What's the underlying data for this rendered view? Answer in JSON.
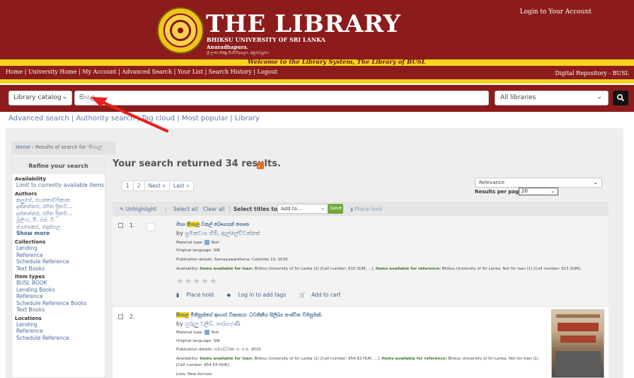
{
  "banner": {
    "title": "THE LIBRARY",
    "subtitle": "BHIKSU UNIVERSITY OF SRI LANKA",
    "city": "Anuradhapura.",
    "tagline": "ශ්‍රී ලංකා භික්ෂු විශ්වවිද්‍යාලය, අනුරාධපුරය.",
    "login": "Login to Your Account",
    "welcome": "Welcome to the Library System, The Library of BUSL"
  },
  "topnav": {
    "links": [
      "Home",
      "University Home",
      "My Account",
      "Advanced Search",
      "Your List",
      "Search History",
      "Logout"
    ],
    "separator": " | ",
    "repository": "Digital Repository - BUSL"
  },
  "search": {
    "catalog": "Library catalog",
    "query": "සිංහල",
    "library": "All libraries"
  },
  "subnav": {
    "items": [
      "Advanced search",
      "Authority search",
      "Tag cloud",
      "Most popular",
      "Library"
    ],
    "separator": " | "
  },
  "breadcrumb": {
    "home": "Home",
    "current": "Results of search for 'සිංහල'"
  },
  "facets": {
    "heading": "Refine your search",
    "availability_label": "Availability",
    "availability_item": "Limit to currently available items",
    "authors_label": "Authors",
    "authors": [
      "කලුපේ, ජයකොඩිපිකාන",
      "දන්නන්නර, රජිත ප්‍රිතම්...",
      "දන්නන්නර, රජිත ප්‍රිතම්...",
      "මූලිංග, පී. එස්. වී",
      "ජයසෙකර, දොන්ගල"
    ],
    "show_more": "Show more",
    "collections_label": "Collections",
    "collections": [
      "Lending",
      "Reference",
      "Schedule Reference",
      "Text Books"
    ],
    "itemtypes_label": "Item types",
    "itemtypes": [
      "BUSL BOOK",
      "Lending Books",
      "Reference",
      "Schedule Reference Books",
      "Text Books"
    ],
    "locations_label": "Locations",
    "locations": [
      "Lending",
      "Reference",
      "Schedule Reference"
    ]
  },
  "results": {
    "summary": "Your search returned 34 results.",
    "pager": [
      "1",
      "2",
      "Next »",
      "Last »"
    ],
    "sort": "Relevance",
    "rpp_label": "Results per page:",
    "rpp": "20",
    "toolbar": {
      "unhighlight": "Unhighlight",
      "select_all": "Select all",
      "clear_all": "Clear all",
      "select_titles": "Select titles to:",
      "add_to": "Add to...",
      "save": "Save",
      "place_hold": "Place hold"
    },
    "records": [
      {
        "num": "1.",
        "title_pre": "මහා ",
        "title_hl": "සිංහල",
        "title_post": " වසල් බෞගයන් ගෞන",
        "by_prefix": "by",
        "author": "සුමනවංශ හිමි, ඇල්ලේව්වත්තේ",
        "material_label": "Material type:",
        "material": "Text",
        "language": "Original language: SIN",
        "publication": "Publication details: Samayawardhana: Colombo 10, 2018",
        "avail_label": "Availability:",
        "avail_loan_label": "Items available for loan:",
        "avail_loan": "Bhiksu University of Sri Lanka (2) [Call number: 615 SUM, ...].",
        "avail_ref_label": "Items available for reference:",
        "avail_ref": "Bhiksu University of Sri Lanka: Not for loan (1) [Call number: 615 SUM].",
        "actions": [
          "Place hold",
          "Log in to add tags",
          "Add to cart"
        ]
      },
      {
        "num": "2.",
        "title_pre": "",
        "title_hl": "සිංහල",
        "title_post": " මිනිසුන්ගේ ආහාර විකාසය: ධවනිකීය සිලිඛ්‍ය සංශ්වීන විමසුමක්.",
        "by_prefix": "by",
        "author": "හුරුලු වලිබ්. පාරගහණී",
        "material_label": "Material type:",
        "material": "Text",
        "language": "Original language: SIN",
        "publication": "Publication details: සමයවර්ධන: ස. ස.ප. 2019",
        "avail_label": "Availability:",
        "avail_loan_label": "Items available for loan:",
        "avail_loan": "Bhiksu University of Sri Lanka (2) [Call number: 954.93 HUR, ...].",
        "avail_ref_label": "Items available for reference:",
        "avail_ref": "Bhiksu University of Sri Lanka: Not for loan (1)",
        "avail_ref2": "[Call number: 954.93 HUR].",
        "lists": "Lists: New Arrivals"
      }
    ]
  },
  "colors": {
    "maroon": "#8c1c1c",
    "yellow": "#f5d51c",
    "link": "#4a6c9b",
    "annotation_arrow": "#e8201e"
  }
}
